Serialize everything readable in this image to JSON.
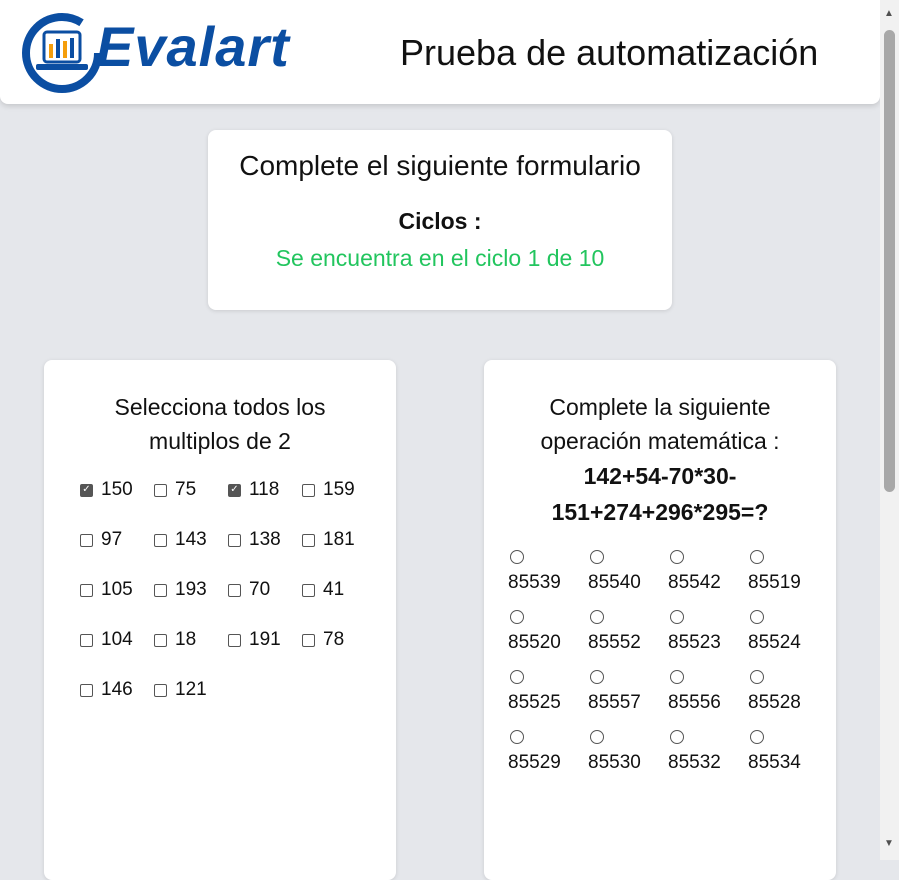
{
  "header": {
    "logo_text": "Evalart",
    "title": "Prueba de automatización"
  },
  "cycle": {
    "heading": "Complete el siguiente formulario",
    "label": "Ciclos :",
    "status": "Se encuentra en el ciclo 1 de 10"
  },
  "multiples": {
    "question": "Selecciona todos los multiplos de 2",
    "options": [
      {
        "label": "150",
        "checked": true
      },
      {
        "label": "75",
        "checked": false
      },
      {
        "label": "118",
        "checked": true
      },
      {
        "label": "159",
        "checked": false
      },
      {
        "label": "97",
        "checked": false
      },
      {
        "label": "143",
        "checked": false
      },
      {
        "label": "138",
        "checked": false
      },
      {
        "label": "181",
        "checked": false
      },
      {
        "label": "105",
        "checked": false
      },
      {
        "label": "193",
        "checked": false
      },
      {
        "label": "70",
        "checked": false
      },
      {
        "label": "41",
        "checked": false
      },
      {
        "label": "104",
        "checked": false
      },
      {
        "label": "18",
        "checked": false
      },
      {
        "label": "191",
        "checked": false
      },
      {
        "label": "78",
        "checked": false
      },
      {
        "label": "146",
        "checked": false
      },
      {
        "label": "121",
        "checked": false
      }
    ]
  },
  "math": {
    "question": "Complete la siguiente operación matemática :",
    "operation": "142+54-70*30-151+274+296*295=?",
    "options": [
      "85539",
      "85540",
      "85542",
      "85519",
      "85520",
      "85552",
      "85523",
      "85524",
      "85525",
      "85557",
      "85556",
      "85528",
      "85529",
      "85530",
      "85532",
      "85534"
    ]
  },
  "colors": {
    "accent_green": "#22c55e",
    "brand_blue": "#0b4ea2"
  }
}
